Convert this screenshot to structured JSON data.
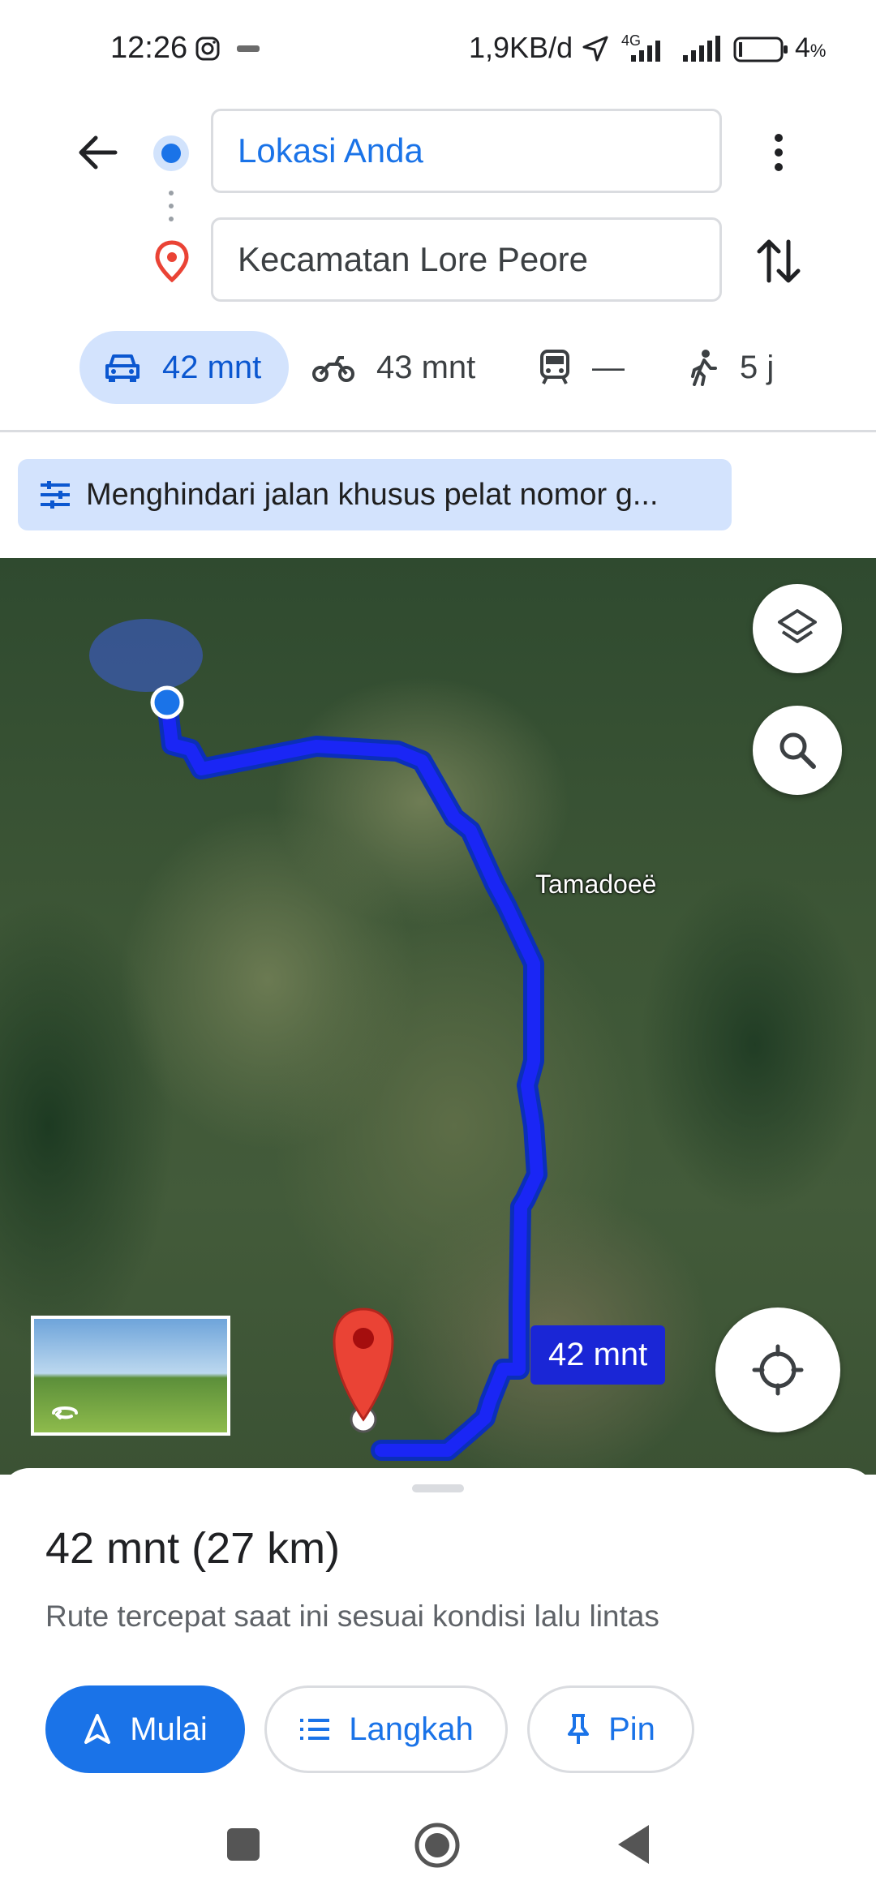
{
  "status_bar": {
    "time": "12:26",
    "network_speed": "1,9KB/d",
    "network_type": "4G",
    "battery": "4",
    "battery_unit": "%",
    "icons": [
      "instagram-icon",
      "notification-icon",
      "location-arrow-icon",
      "signal-icon",
      "signal-icon",
      "battery-icon"
    ]
  },
  "directions": {
    "origin": "Lokasi Anda",
    "destination": "Kecamatan Lore Peore"
  },
  "modes": [
    {
      "icon": "car-icon",
      "label": "42 mnt",
      "selected": true
    },
    {
      "icon": "motorcycle-icon",
      "label": "43 mnt"
    },
    {
      "icon": "transit-icon",
      "label": "—"
    },
    {
      "icon": "walk-icon",
      "label": "5 j"
    }
  ],
  "options_chip": "Menghindari jalan khusus pelat nomor g...",
  "map": {
    "place_label": "Tamadoeë",
    "route_eta": "42 mnt",
    "route_color": "#1a26f5",
    "thumbnail_icon": "street-view-icon"
  },
  "sheet": {
    "summary": "42 mnt (27 km)",
    "description": "Rute tercepat saat ini sesuai kondisi lalu lintas",
    "buttons": {
      "start": "Mulai",
      "steps": "Langkah",
      "pin": "Pin"
    }
  },
  "colors": {
    "accent": "#1a73e8",
    "chip_bg": "#d3e3fd",
    "destination_pin": "#ea4335"
  }
}
